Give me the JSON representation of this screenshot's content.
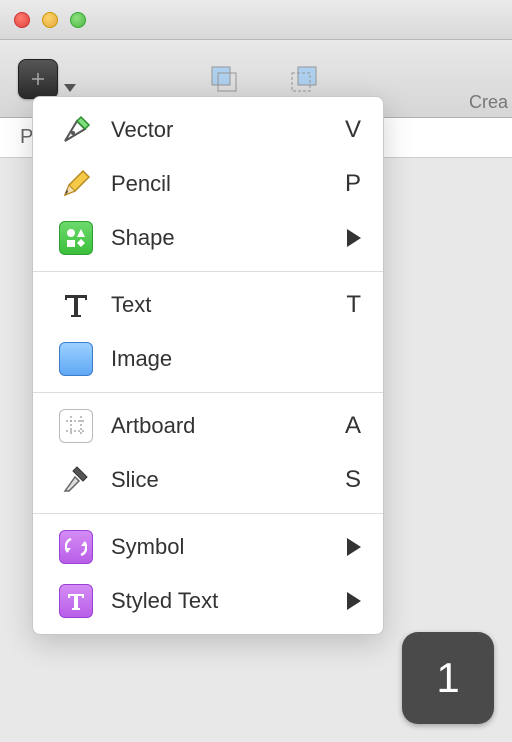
{
  "sidebar_page_label": "P",
  "toolbar_truncated_label": "Crea",
  "badge_number": "1",
  "menu": {
    "groups": [
      [
        {
          "id": "vector",
          "label": "Vector",
          "shortcut": "V",
          "icon": "pen-nib"
        },
        {
          "id": "pencil",
          "label": "Pencil",
          "shortcut": "P",
          "icon": "pencil"
        },
        {
          "id": "shape",
          "label": "Shape",
          "submenu": true,
          "icon": "shapes-tile"
        }
      ],
      [
        {
          "id": "text",
          "label": "Text",
          "shortcut": "T",
          "icon": "text-t"
        },
        {
          "id": "image",
          "label": "Image",
          "icon": "image-tile"
        }
      ],
      [
        {
          "id": "artboard",
          "label": "Artboard",
          "shortcut": "A",
          "icon": "artboard-grid"
        },
        {
          "id": "slice",
          "label": "Slice",
          "shortcut": "S",
          "icon": "scalpel"
        }
      ],
      [
        {
          "id": "symbol",
          "label": "Symbol",
          "submenu": true,
          "icon": "symbol-tile"
        },
        {
          "id": "styled_text",
          "label": "Styled Text",
          "submenu": true,
          "icon": "styled-text-tile"
        }
      ]
    ]
  }
}
